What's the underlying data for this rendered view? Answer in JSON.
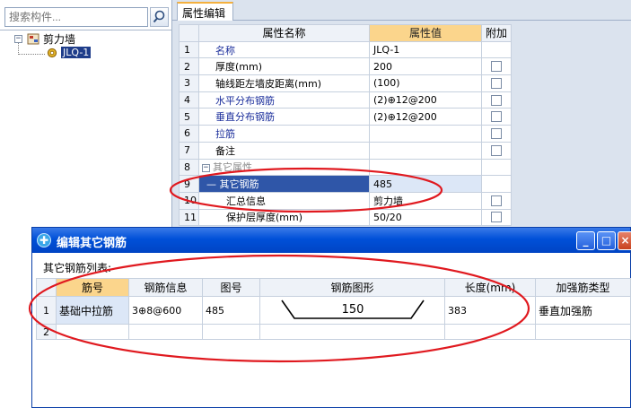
{
  "search": {
    "placeholder": "搜索构件..."
  },
  "tree": {
    "root": {
      "label": "剪力墙",
      "expander": "−"
    },
    "child": {
      "label": "JLQ-1"
    }
  },
  "tab": {
    "label": "属性编辑"
  },
  "prop_grid": {
    "headers": {
      "name": "属性名称",
      "value": "属性值",
      "attach": "附加"
    },
    "rows": [
      {
        "num": "1",
        "name": "名称",
        "value": "JLQ-1"
      },
      {
        "num": "2",
        "name": "厚度(mm)",
        "value": "200"
      },
      {
        "num": "3",
        "name": "轴线距左墙皮距离(mm)",
        "value": "(100)"
      },
      {
        "num": "4",
        "name": "水平分布钢筋",
        "value": "(2)⊕12@200"
      },
      {
        "num": "5",
        "name": "垂直分布钢筋",
        "value": "(2)⊕12@200"
      },
      {
        "num": "6",
        "name": "拉筋",
        "value": ""
      },
      {
        "num": "7",
        "name": "备注",
        "value": ""
      },
      {
        "num": "8",
        "name": "其它属性",
        "value": "",
        "expander": "−"
      },
      {
        "num": "9",
        "name": "其它钢筋",
        "value": "485"
      },
      {
        "num": "10",
        "name": "汇总信息",
        "value": "剪力墙"
      },
      {
        "num": "11",
        "name": "保护层厚度(mm)",
        "value": "50/20"
      }
    ]
  },
  "dialog": {
    "title": "编辑其它钢筋",
    "list_label": "其它钢筋列表:",
    "buttons": {
      "minimize": "_",
      "maximize": "□",
      "close": "×"
    },
    "headers": {
      "bar_no": "筋号",
      "bar_info": "钢筋信息",
      "fig_no": "图号",
      "bar_shape": "钢筋图形",
      "length": "长度(mm)",
      "reinforce_type": "加强筋类型"
    },
    "rows": [
      {
        "num": "1",
        "bar_no": "基础中拉筋",
        "bar_info": "3⊕8@600",
        "fig_no": "485",
        "shape_dim": "150",
        "length": "383",
        "reinforce_type": "垂直加强筋"
      },
      {
        "num": "2",
        "bar_no": "",
        "bar_info": "",
        "fig_no": "",
        "shape_dim": "",
        "length": "",
        "reinforce_type": ""
      }
    ]
  },
  "colors": {
    "annotation": "#e0191f",
    "header_highlight": "#fbd58c",
    "selection": "#2f56a8",
    "title_bar": "#0050d8"
  },
  "icons": {
    "search": "search-icon",
    "wall": "wall-icon",
    "component": "gear-icon",
    "dialog": "dialog-app-icon"
  }
}
